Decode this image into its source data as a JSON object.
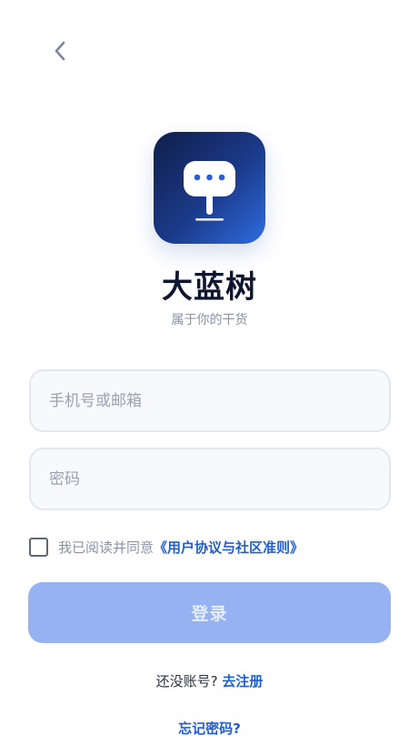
{
  "app": {
    "name": "大蓝树",
    "tagline": "属于你的干货"
  },
  "form": {
    "phone_placeholder": "手机号或邮箱",
    "phone_value": "",
    "password_placeholder": "密码",
    "password_value": "",
    "agreement_checked": false,
    "agreement_text": "我已阅读并同意",
    "agreement_link": "《用户协议与社区准则》",
    "login_label": "登录"
  },
  "footer": {
    "register_prompt": "还没账号?",
    "register_link": "去注册",
    "forgot_link": "忘记密码?"
  },
  "icons": {
    "back": "chevron-left-icon",
    "logo": "chat-bubble-signpost-icon"
  },
  "colors": {
    "accent": "#1f5fd1",
    "login_button_disabled": "#96b2f0",
    "logo_gradient_start": "#0f1f4a",
    "logo_gradient_end": "#2e6de0",
    "title": "#0f1730",
    "muted": "#8a93a6"
  }
}
